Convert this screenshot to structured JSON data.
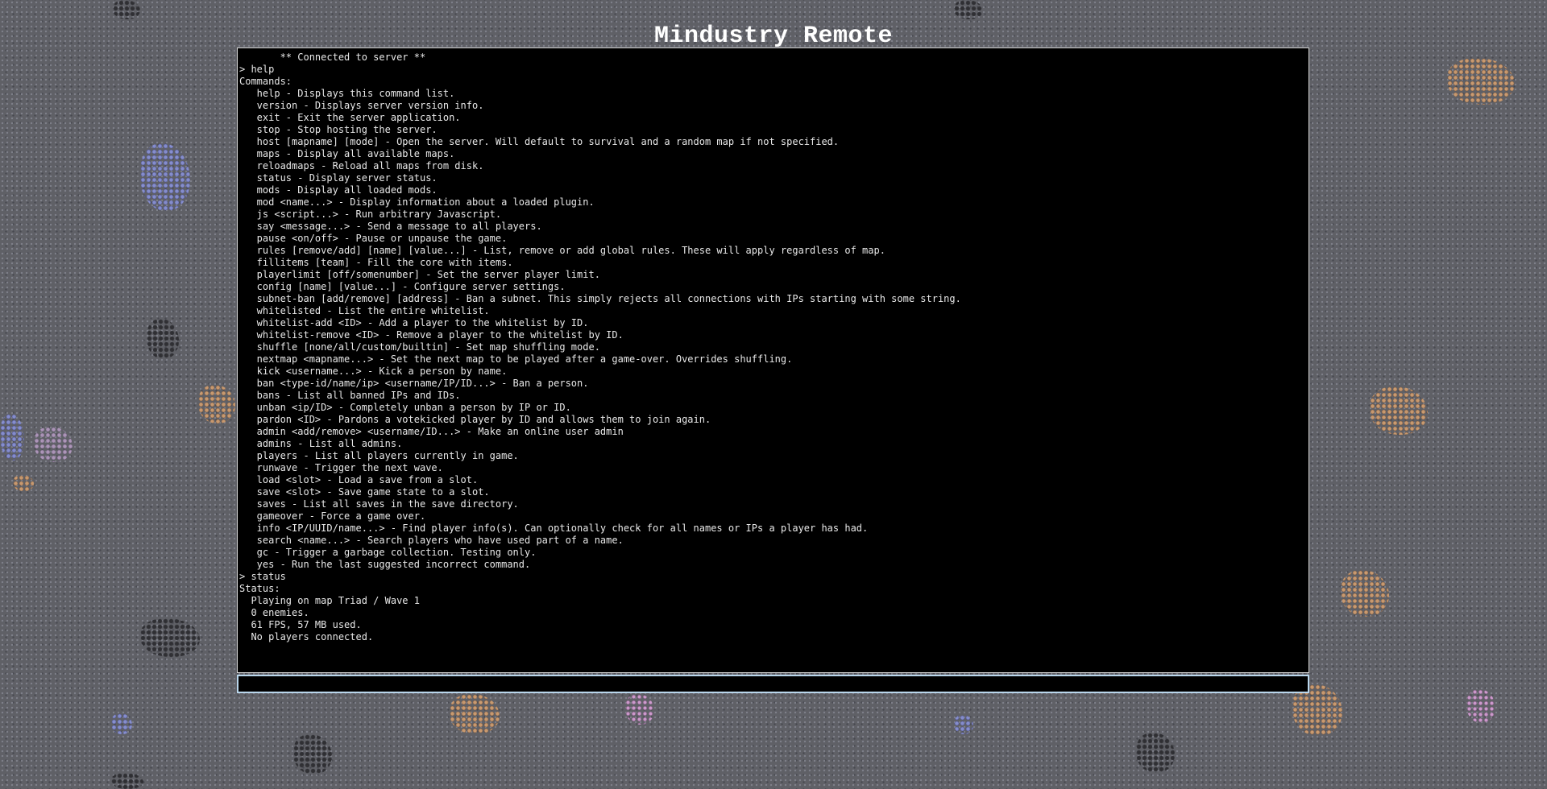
{
  "page": {
    "title": "Mindustry Remote"
  },
  "console": {
    "lines": [
      "       ** Connected to server **",
      "> help",
      "Commands:",
      "   help - Displays this command list.",
      "   version - Displays server version info.",
      "   exit - Exit the server application.",
      "   stop - Stop hosting the server.",
      "   host [mapname] [mode] - Open the server. Will default to survival and a random map if not specified.",
      "   maps - Display all available maps.",
      "   reloadmaps - Reload all maps from disk.",
      "   status - Display server status.",
      "   mods - Display all loaded mods.",
      "   mod <name...> - Display information about a loaded plugin.",
      "   js <script...> - Run arbitrary Javascript.",
      "   say <message...> - Send a message to all players.",
      "   pause <on/off> - Pause or unpause the game.",
      "   rules [remove/add] [name] [value...] - List, remove or add global rules. These will apply regardless of map.",
      "   fillitems [team] - Fill the core with items.",
      "   playerlimit [off/somenumber] - Set the server player limit.",
      "   config [name] [value...] - Configure server settings.",
      "   subnet-ban [add/remove] [address] - Ban a subnet. This simply rejects all connections with IPs starting with some string.",
      "   whitelisted - List the entire whitelist.",
      "   whitelist-add <ID> - Add a player to the whitelist by ID.",
      "   whitelist-remove <ID> - Remove a player to the whitelist by ID.",
      "   shuffle [none/all/custom/builtin] - Set map shuffling mode.",
      "   nextmap <mapname...> - Set the next map to be played after a game-over. Overrides shuffling.",
      "   kick <username...> - Kick a person by name.",
      "   ban <type-id/name/ip> <username/IP/ID...> - Ban a person.",
      "   bans - List all banned IPs and IDs.",
      "   unban <ip/ID> - Completely unban a person by IP or ID.",
      "   pardon <ID> - Pardons a votekicked player by ID and allows them to join again.",
      "   admin <add/remove> <username/ID...> - Make an online user admin",
      "   admins - List all admins.",
      "   players - List all players currently in game.",
      "   runwave - Trigger the next wave.",
      "   load <slot> - Load a save from a slot.",
      "   save <slot> - Save game state to a slot.",
      "   saves - List all saves in the save directory.",
      "   gameover - Force a game over.",
      "   info <IP/UUID/name...> - Find player info(s). Can optionally check for all names or IPs a player has had.",
      "   search <name...> - Search players who have used part of a name.",
      "   gc - Trigger a garbage collection. Testing only.",
      "   yes - Run the last suggested incorrect command.",
      "> status",
      "Status:",
      "  Playing on map Triad / Wave 1",
      "  0 enemies.",
      "  61 FPS, 57 MB used.",
      "  No players connected."
    ]
  },
  "input": {
    "value": "",
    "placeholder": ""
  },
  "colors": {
    "background": "#5f6066",
    "console_bg": "#000000",
    "console_text": "#e8e8e8",
    "input_border": "#b9d6ec",
    "title": "#ffffff"
  }
}
